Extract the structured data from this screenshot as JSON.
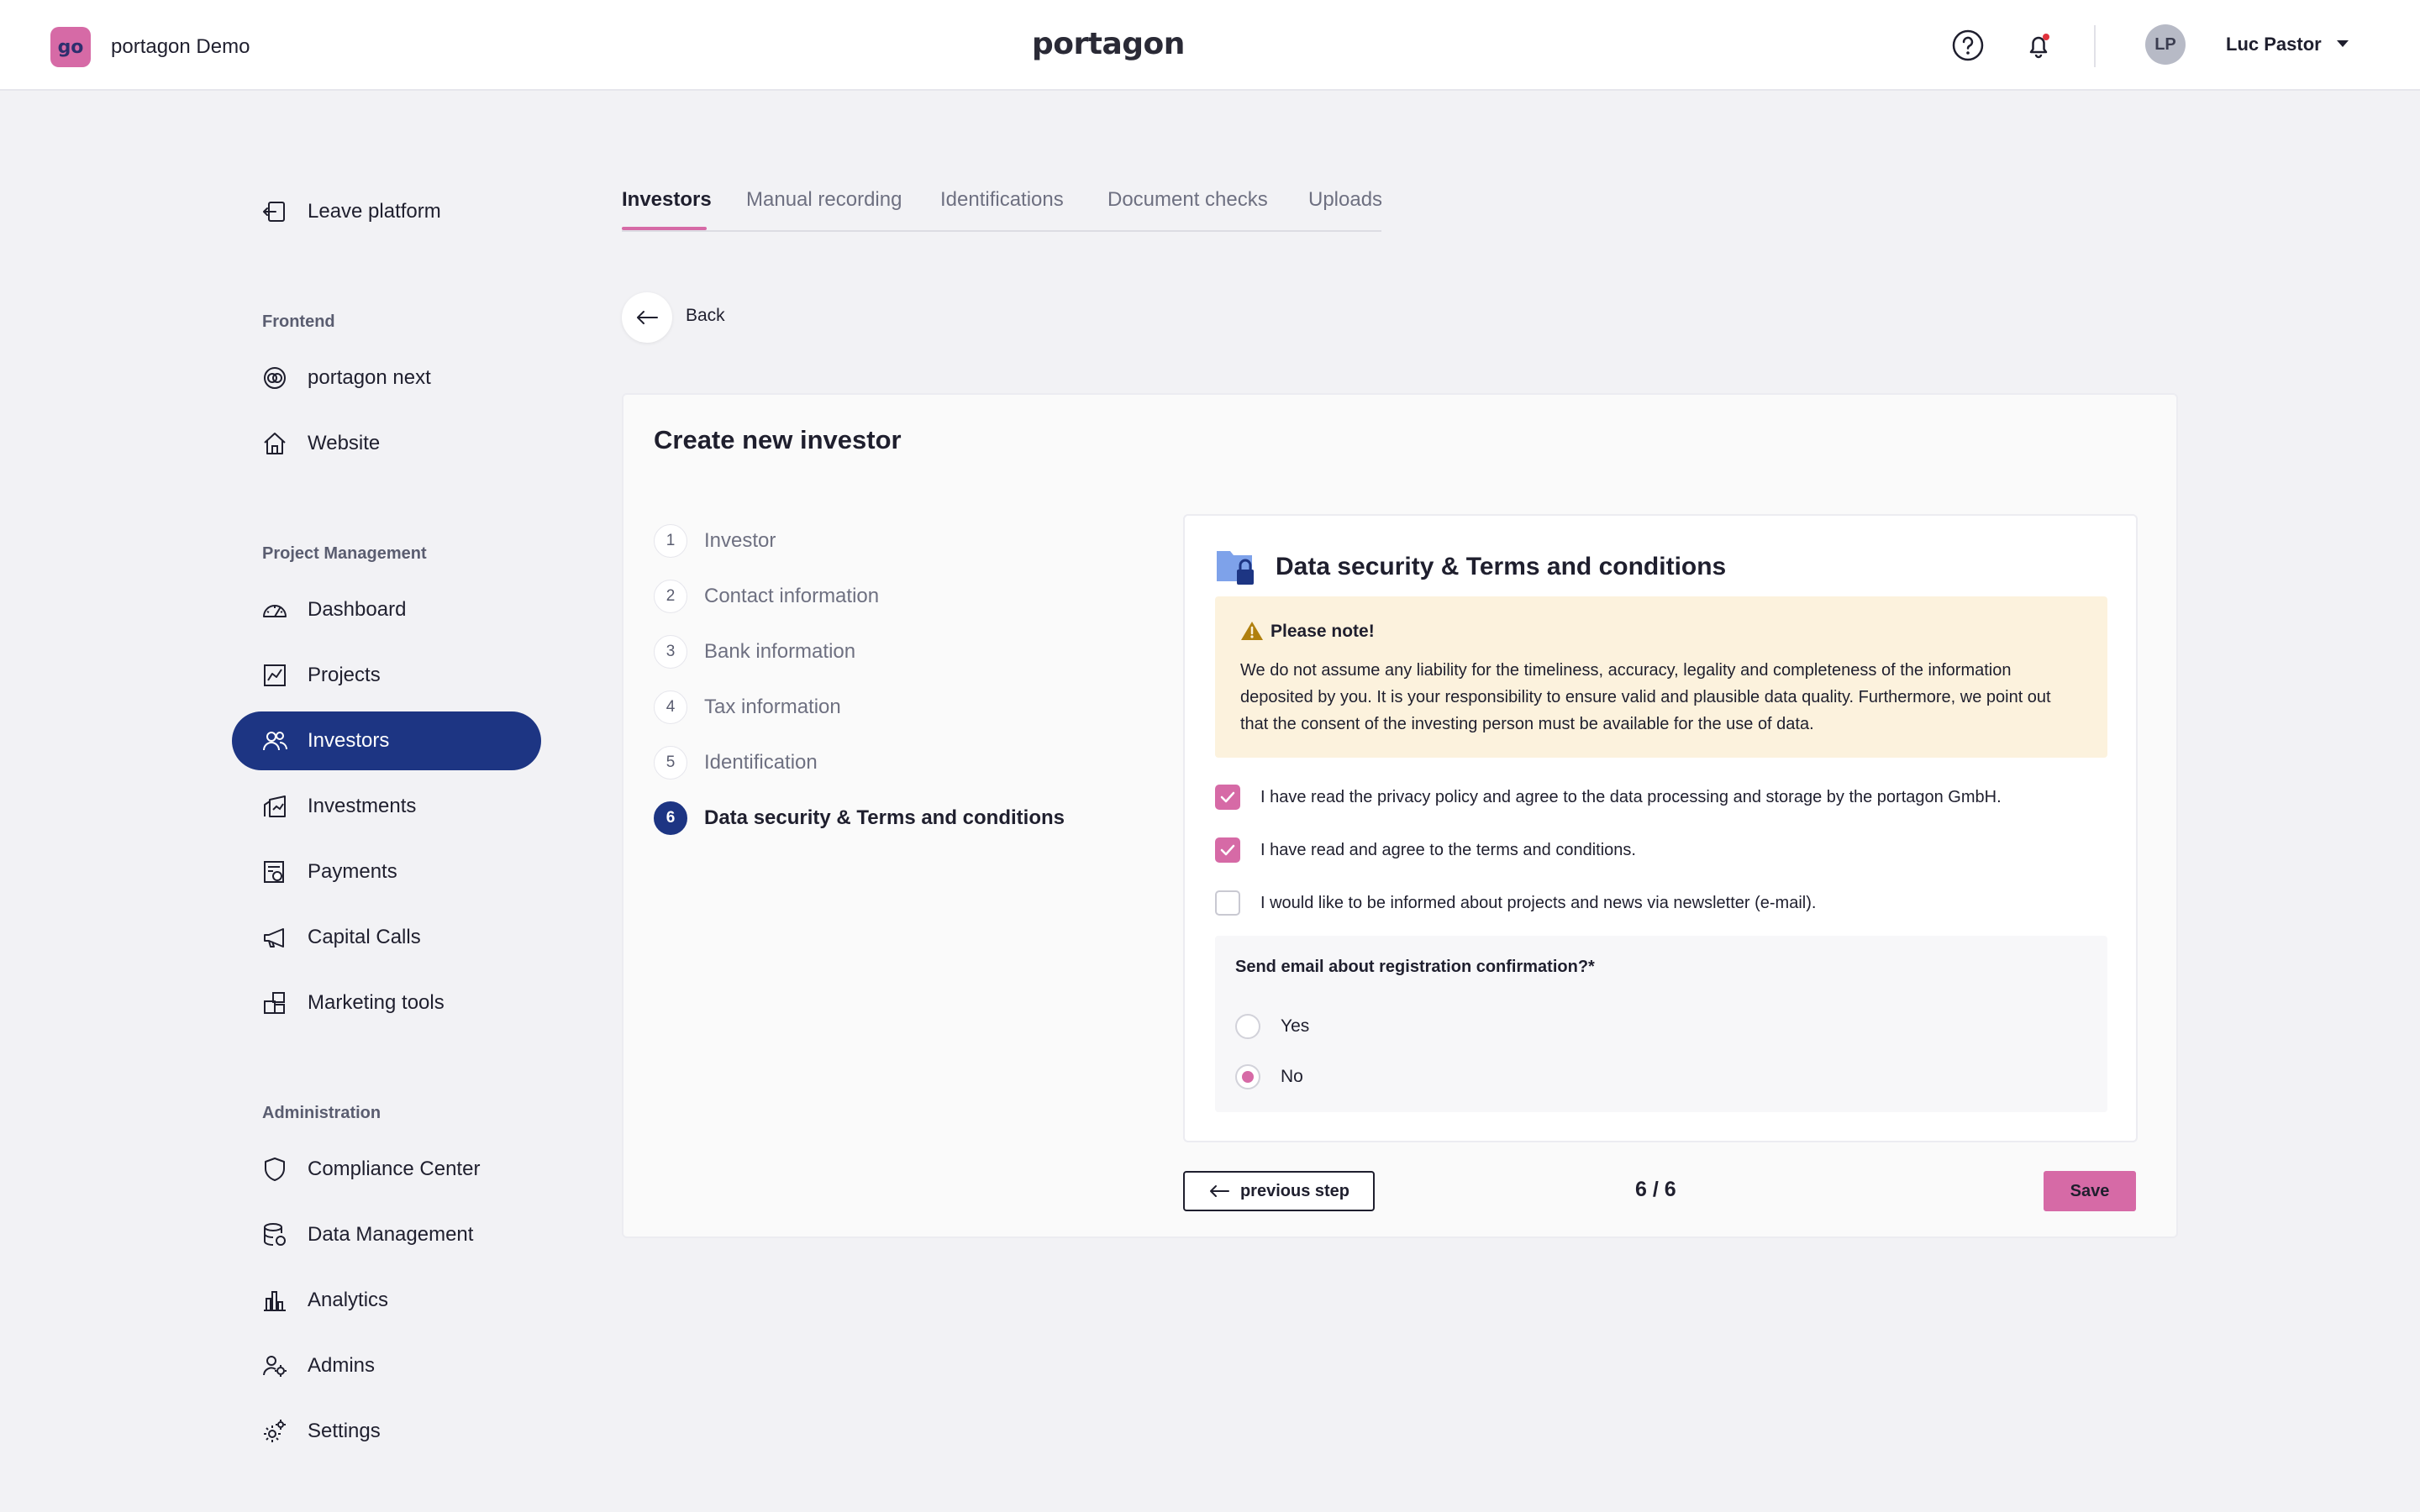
{
  "header": {
    "logo_text": "go",
    "app_name": "portagon Demo",
    "brand": "portagon",
    "user_initials": "LP",
    "user_name": "Luc Pastor"
  },
  "sidebar": {
    "leave": "Leave platform",
    "sections": {
      "frontend": "Frontend",
      "project_management": "Project Management",
      "administration": "Administration"
    },
    "frontend_items": [
      {
        "label": "portagon next",
        "icon": "portagon-next-icon"
      },
      {
        "label": "Website",
        "icon": "home-icon"
      }
    ],
    "pm_items": [
      {
        "label": "Dashboard",
        "icon": "gauge-icon"
      },
      {
        "label": "Projects",
        "icon": "chart-icon"
      },
      {
        "label": "Investors",
        "icon": "users-icon"
      },
      {
        "label": "Investments",
        "icon": "investments-icon"
      },
      {
        "label": "Payments",
        "icon": "payments-icon"
      },
      {
        "label": "Capital Calls",
        "icon": "megaphone-icon"
      },
      {
        "label": "Marketing tools",
        "icon": "cubes-icon"
      }
    ],
    "admin_items": [
      {
        "label": "Compliance Center",
        "icon": "shield-icon"
      },
      {
        "label": "Data Management",
        "icon": "database-icon"
      },
      {
        "label": "Analytics",
        "icon": "bar-chart-icon"
      },
      {
        "label": "Admins",
        "icon": "admin-user-icon"
      },
      {
        "label": "Settings",
        "icon": "gear-icon"
      }
    ]
  },
  "tabs": [
    "Investors",
    "Manual recording",
    "Identifications",
    "Document checks",
    "Uploads"
  ],
  "back_label": "Back",
  "card": {
    "title": "Create new investor",
    "steps": [
      {
        "num": "1",
        "label": "Investor"
      },
      {
        "num": "2",
        "label": "Contact information"
      },
      {
        "num": "3",
        "label": "Bank information"
      },
      {
        "num": "4",
        "label": "Tax information"
      },
      {
        "num": "5",
        "label": "Identification"
      },
      {
        "num": "6",
        "label": "Data security & Terms and conditions"
      }
    ],
    "section_title": "Data security & Terms and conditions",
    "note_title": "Please note!",
    "note_body": "We do not assume any liability for the timeliness, accuracy, legality and completeness of the information deposited by you. It is your responsibility to ensure valid and plausible data quality. Furthermore, we point out that the consent of the investing person must be available for the use of data.",
    "checkboxes": [
      {
        "label": "I have read the privacy policy and agree to the data processing and storage by the portagon GmbH.",
        "checked": true
      },
      {
        "label": "I have read and agree to the terms and conditions.",
        "checked": true
      },
      {
        "label": "I would like to be informed about projects and news via newsletter (e-mail).",
        "checked": false
      }
    ],
    "radio_question": "Send email about registration confirmation?*",
    "radio_options": [
      {
        "label": "Yes",
        "selected": false
      },
      {
        "label": "No",
        "selected": true
      }
    ],
    "prev_label": "previous step",
    "pager": "6 / 6",
    "save_label": "Save"
  },
  "colors": {
    "accent": "#d66aa6",
    "navy": "#1d3583",
    "note_bg": "#fcf2dd"
  }
}
